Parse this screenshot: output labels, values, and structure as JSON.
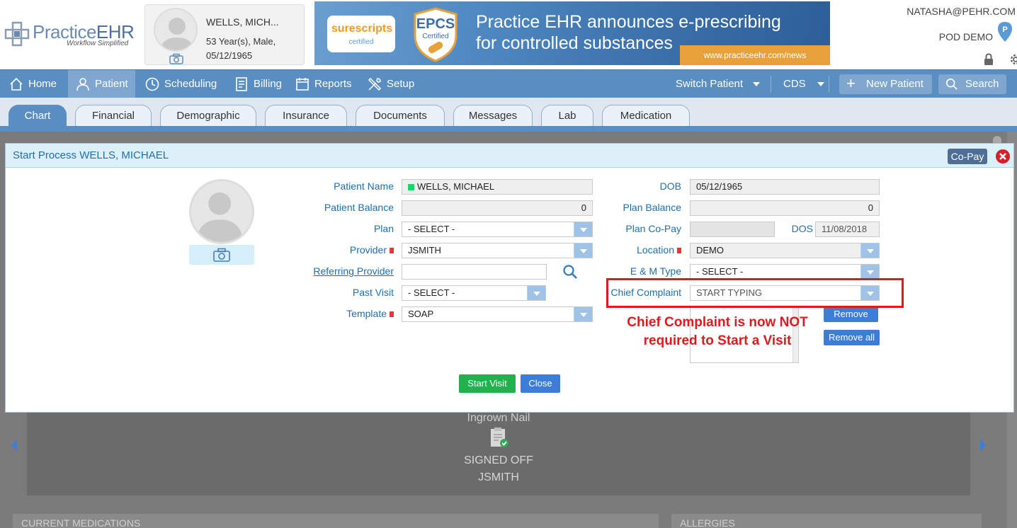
{
  "header": {
    "logo_prefix": "Practice",
    "logo_suffix": "EHR",
    "tagline": "Workflow Simplified",
    "patient_card": {
      "name": "WELLS, MICH...",
      "age_sex": "53 Year(s), Male,",
      "dob": "05/12/1965"
    },
    "banner": {
      "surescripts": "surescripts",
      "surescripts_sub": "certified",
      "epcs": "EPCS",
      "epcs_sub": "Certified",
      "headline_1": "Practice EHR announces e-prescribing",
      "headline_2": "for controlled substances",
      "url": "www.practiceehr.com/news"
    },
    "user_email": "NATASHA@PEHR.COM",
    "practice": "POD DEMO"
  },
  "nav": {
    "home": "Home",
    "patient": "Patient",
    "scheduling": "Scheduling",
    "billing": "Billing",
    "reports": "Reports",
    "setup": "Setup",
    "switch_patient": "Switch Patient",
    "cds": "CDS",
    "new_patient": "New Patient",
    "search": "Search"
  },
  "tabs": [
    "Chart",
    "Financial",
    "Demographic",
    "Insurance",
    "Documents",
    "Messages",
    "Lab",
    "Medication"
  ],
  "background": {
    "visit_title": "Ingrown Nail",
    "status_1": "SIGNED OFF",
    "status_2": "JSMITH",
    "panel_left": "CURRENT MEDICATIONS",
    "panel_right": "ALLERGIES"
  },
  "modal": {
    "title": "Start Process WELLS, MICHAEL",
    "copay": "Co-Pay",
    "labels": {
      "patient_name": "Patient Name",
      "patient_balance": "Patient Balance",
      "plan": "Plan",
      "provider": "Provider",
      "referring_provider": "Referring Provider",
      "past_visit": "Past Visit",
      "template": "Template",
      "dob": "DOB",
      "plan_balance": "Plan Balance",
      "plan_copay": "Plan Co-Pay",
      "dos": "DOS",
      "location": "Location",
      "em_type": "E & M Type",
      "chief_complaint": "Chief Complaint"
    },
    "values": {
      "patient_name": "WELLS, MICHAEL",
      "patient_balance": "0",
      "plan": "- SELECT -",
      "provider": "JSMITH",
      "referring_provider": "",
      "past_visit": "- SELECT -",
      "template": "SOAP",
      "dob": "05/12/1965",
      "plan_balance": "0",
      "plan_copay": "",
      "dos": "11/08/2018",
      "location": "DEMO",
      "em_type": "- SELECT -",
      "chief_complaint_placeholder": "START TYPING"
    },
    "buttons": {
      "remove": "Remove",
      "remove_all": "Remove all",
      "start_visit": "Start Visit",
      "close": "Close"
    },
    "annotation_line1": "Chief Complaint is now NOT",
    "annotation_line2": "required to Start a Visit"
  },
  "colors": {
    "nav_bg": "#5b8ec0",
    "label_blue": "#1d6fb0",
    "required_red": "#e03b3b",
    "annotation_red": "#e0191f",
    "start_green": "#22b14c",
    "button_blue": "#3b7dd8"
  }
}
